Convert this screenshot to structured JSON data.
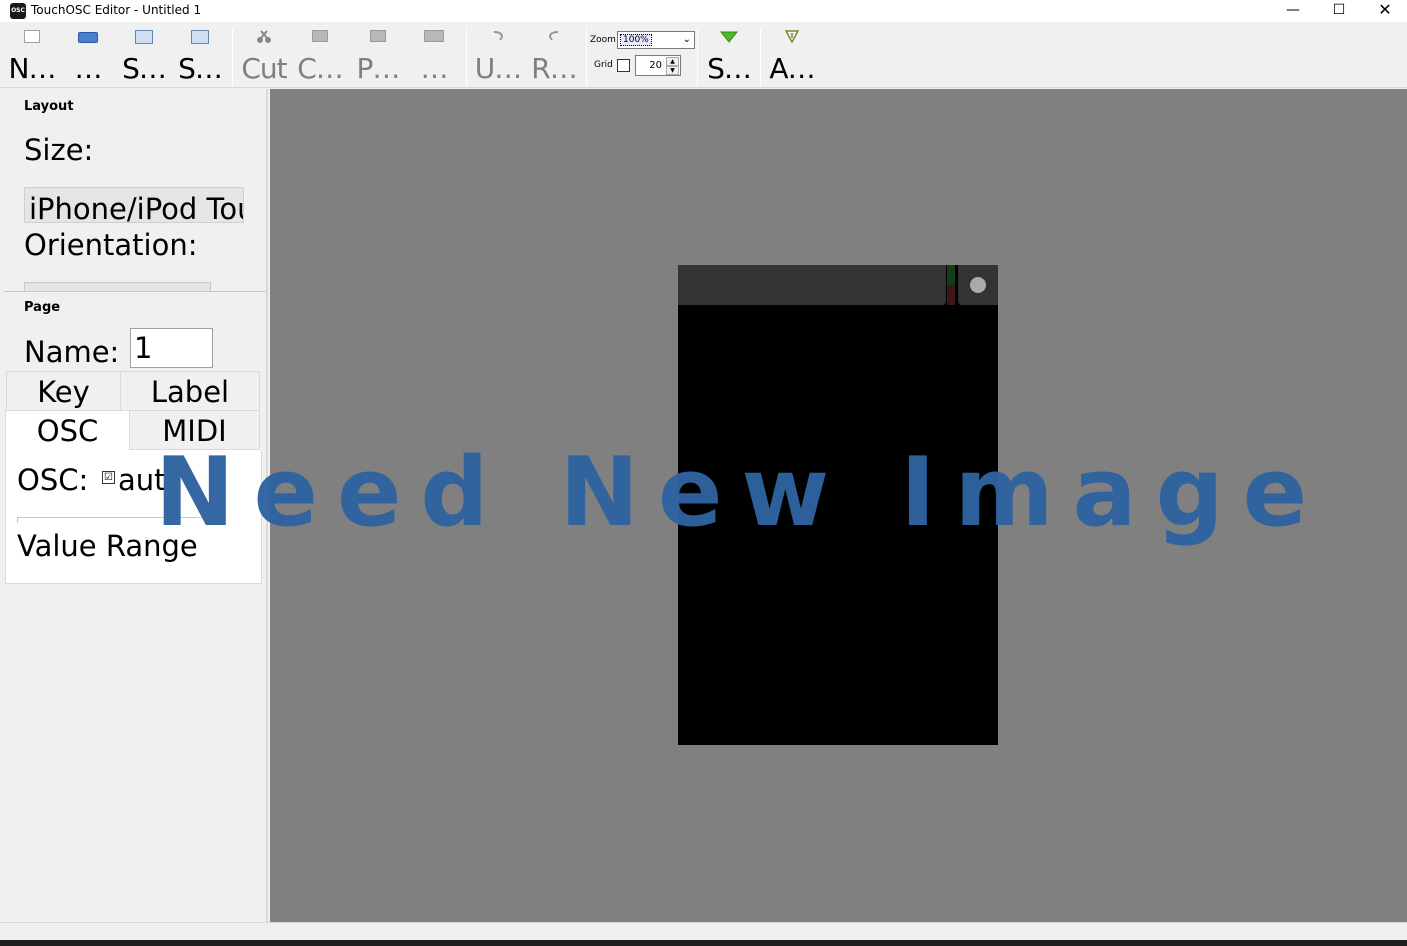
{
  "window": {
    "title": "TouchOSC Editor - Untitled 1",
    "app_icon_text": "OSC",
    "minimize": "—",
    "maximize": "☐",
    "close": "✕"
  },
  "toolbar": {
    "new": "N…",
    "open": "…",
    "save": "S…",
    "save_as": "S…",
    "cut": "Cut",
    "copy": "C…",
    "paste": "P…",
    "delete": "…",
    "undo": "U…",
    "redo": "R…",
    "zoom_label": "Zoom",
    "zoom_value": "100%",
    "grid_label": "Grid",
    "grid_value": "20",
    "sync": "S…",
    "about": "A…"
  },
  "layout_panel": {
    "title": "Layout",
    "size_label": "Size:",
    "size_value": "iPhone/iPod Tou",
    "orientation_label": "Orientation:"
  },
  "page_panel": {
    "title": "Page",
    "name_label": "Name:",
    "name_value": "1",
    "tabs": [
      "Key",
      "Label",
      "OSC",
      "MIDI"
    ],
    "active_tab": "OSC",
    "osc_label": "OSC:",
    "osc_auto_label": "aut",
    "value_range_label": "Value Range"
  },
  "overlay": {
    "text": "Need New Image"
  },
  "colors": {
    "canvas": "#808080",
    "device": "#000000",
    "overlay": "#2f63a1"
  }
}
